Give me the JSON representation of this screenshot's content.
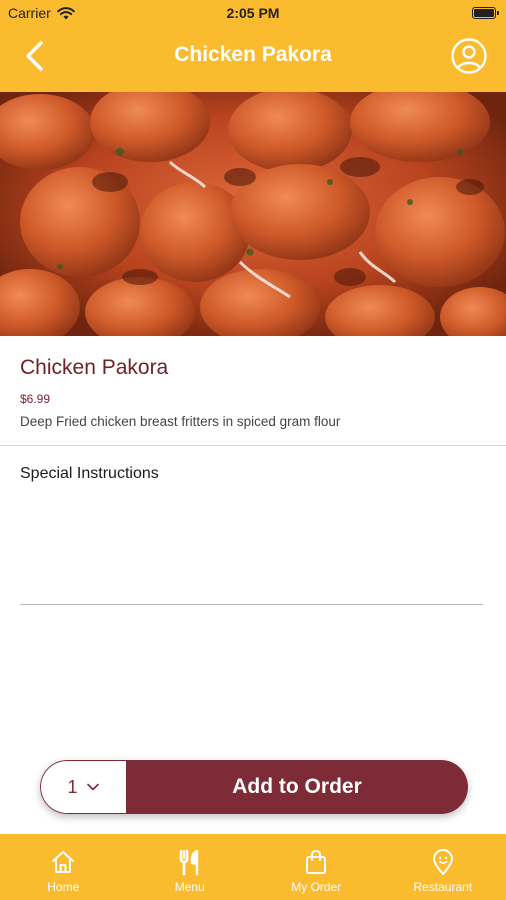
{
  "status_bar": {
    "carrier": "Carrier",
    "time": "2:05 PM"
  },
  "header": {
    "title": "Chicken Pakora",
    "back_icon": "chevron-left-icon",
    "profile_icon": "user-circle-icon"
  },
  "item": {
    "name": "Chicken Pakora",
    "price": "$6.99",
    "description": "Deep Fried chicken breast fritters in spiced gram flour"
  },
  "special_instructions": {
    "label": "Special Instructions",
    "value": ""
  },
  "order": {
    "quantity": "1",
    "add_label": "Add to Order"
  },
  "tabs": [
    {
      "label": "Home",
      "icon": "home-icon"
    },
    {
      "label": "Menu",
      "icon": "utensils-icon"
    },
    {
      "label": "My Order",
      "icon": "shopping-bag-icon"
    },
    {
      "label": "Restaurant",
      "icon": "location-pin-icon"
    }
  ],
  "colors": {
    "primary": "#fbbb2e",
    "accent": "#7d2b37",
    "title_text": "#6e1f28"
  }
}
